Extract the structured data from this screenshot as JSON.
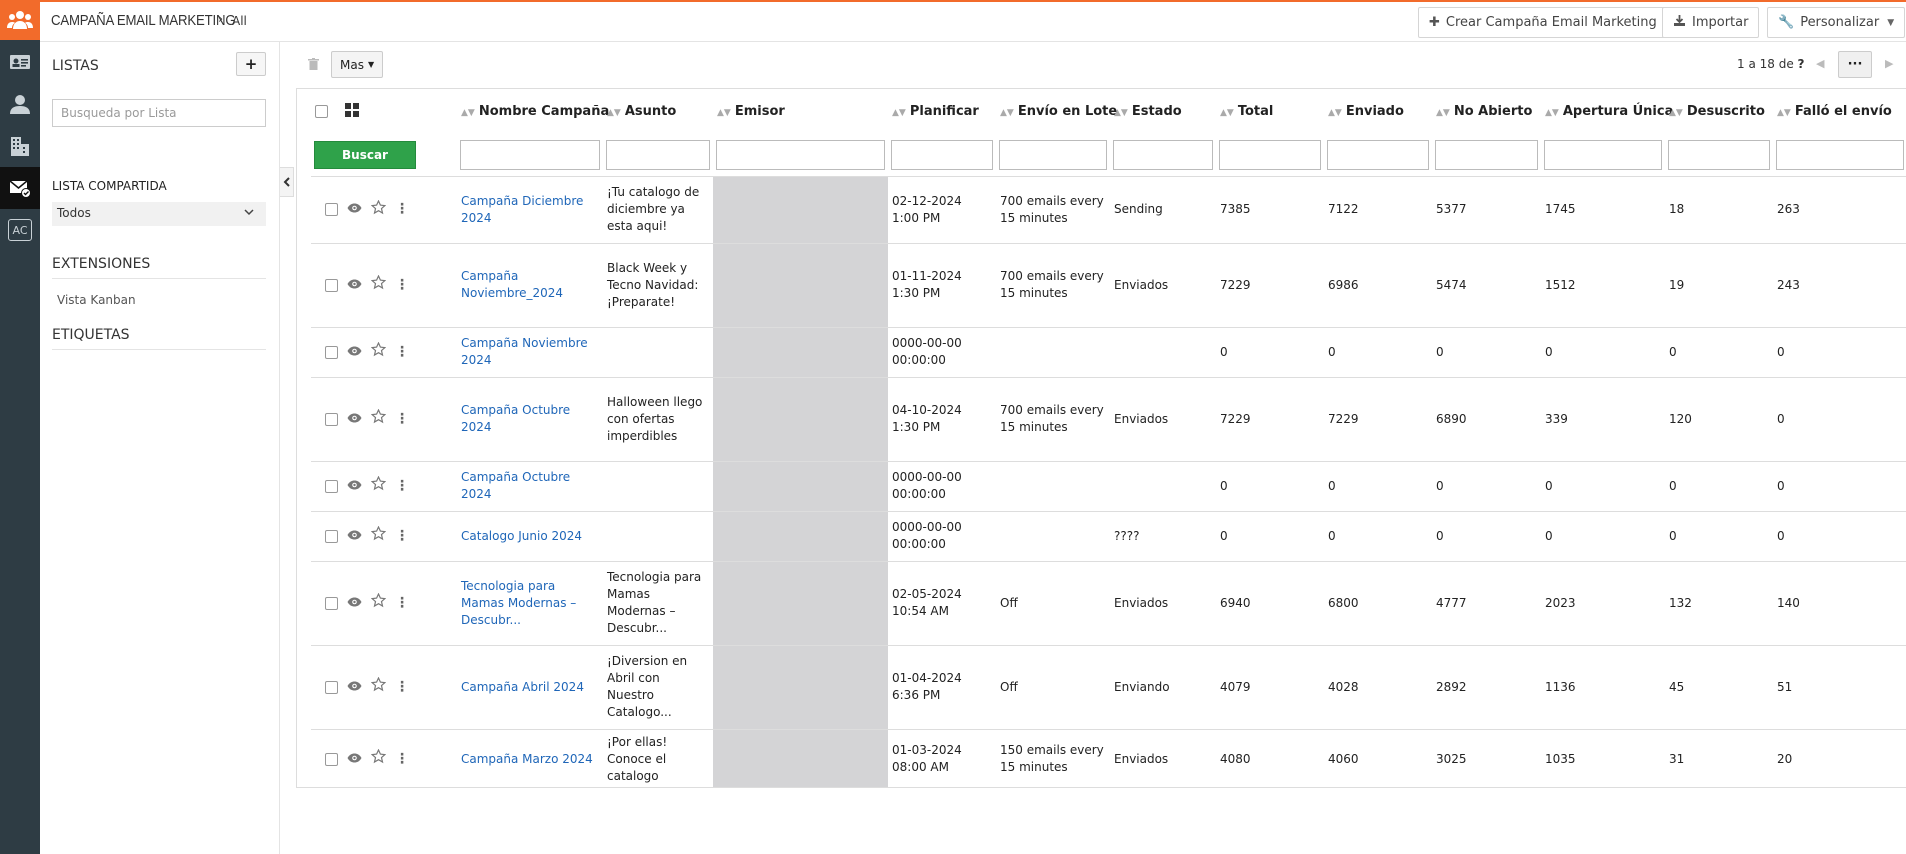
{
  "breadcrumb": {
    "module": "CAMPAÑA EMAIL MARKETING",
    "separator": "›",
    "view": "All"
  },
  "toolbar": {
    "create_label": "Crear Campaña Email Marketing",
    "import_label": "Importar",
    "customize_label": "Personalizar"
  },
  "sidebar": {
    "lists_title": "LISTAS",
    "add_label": "+",
    "search_placeholder": "Busqueda por Lista",
    "shared_list_label": "LISTA COMPARTIDA",
    "shared_list_value": "Todos",
    "extensions_title": "EXTENSIONES",
    "kanban_label": "Vista Kanban",
    "tags_title": "ETIQUETAS"
  },
  "list_toolbar": {
    "more_label": "Mas",
    "pager_text": "1 a 18  de",
    "pager_total": "?",
    "more_options": "···"
  },
  "columns": [
    "Nombre Campaña",
    "Asunto",
    "Emisor",
    "Planificar",
    "Envío en Lote",
    "Estado",
    "Total",
    "Enviado",
    "No Abierto",
    "Apertura Única",
    "Desuscrito",
    "Falló el envío"
  ],
  "search_button": "Buscar",
  "rows": [
    {
      "name": "Campaña Diciembre 2024",
      "subject": "¡Tu catalogo de diciembre ya esta aqui!",
      "schedule": "02-12-2024 1:00 PM",
      "batch": "700 emails every 15 minutes",
      "status": "Sending",
      "total": "7385",
      "sent": "7122",
      "unopened": "5377",
      "unique_open": "1745",
      "unsubscribed": "18",
      "failed": "263"
    },
    {
      "name": "Campaña Noviembre_2024",
      "subject": "Black Week y Tecno Navidad: ¡Preparate!",
      "schedule": "01-11-2024 1:30 PM",
      "batch": "700 emails every 15 minutes",
      "status": "Enviados",
      "total": "7229",
      "sent": "6986",
      "unopened": "5474",
      "unique_open": "1512",
      "unsubscribed": "19",
      "failed": "243"
    },
    {
      "name": "Campaña Noviembre 2024",
      "subject": "",
      "schedule": "0000-00-00 00:00:00",
      "batch": "",
      "status": "",
      "total": "0",
      "sent": "0",
      "unopened": "0",
      "unique_open": "0",
      "unsubscribed": "0",
      "failed": "0"
    },
    {
      "name": "Campaña Octubre 2024",
      "subject": "Halloween llego con ofertas imperdibles",
      "schedule": "04-10-2024 1:30 PM",
      "batch": "700 emails every 15 minutes",
      "status": "Enviados",
      "total": "7229",
      "sent": "7229",
      "unopened": "6890",
      "unique_open": "339",
      "unsubscribed": "120",
      "failed": "0"
    },
    {
      "name": "Campaña Octubre 2024",
      "subject": "",
      "schedule": "0000-00-00 00:00:00",
      "batch": "",
      "status": "",
      "total": "0",
      "sent": "0",
      "unopened": "0",
      "unique_open": "0",
      "unsubscribed": "0",
      "failed": "0"
    },
    {
      "name": "Catalogo Junio 2024",
      "subject": "",
      "schedule": "0000-00-00 00:00:00",
      "batch": "",
      "status": "????",
      "total": "0",
      "sent": "0",
      "unopened": "0",
      "unique_open": "0",
      "unsubscribed": "0",
      "failed": "0"
    },
    {
      "name": "Tecnologia para Mamas Modernas – Descubr...",
      "subject": "Tecnologia para Mamas Modernas – Descubr...",
      "schedule": "02-05-2024 10:54 AM",
      "batch": "Off",
      "status": "Enviados",
      "total": "6940",
      "sent": "6800",
      "unopened": "4777",
      "unique_open": "2023",
      "unsubscribed": "132",
      "failed": "140"
    },
    {
      "name": "Campaña Abril 2024",
      "subject": "¡Diversion en Abril con Nuestro Catalogo...",
      "schedule": "01-04-2024 6:36 PM",
      "batch": "Off",
      "status": "Enviando",
      "total": "4079",
      "sent": "4028",
      "unopened": "2892",
      "unique_open": "1136",
      "unsubscribed": "45",
      "failed": "51"
    },
    {
      "name": "Campaña Marzo 2024",
      "subject": "¡Por ellas! Conoce el catalogo",
      "schedule": "01-03-2024 08:00 AM",
      "batch": "150 emails every 15 minutes",
      "status": "Enviados",
      "total": "4080",
      "sent": "4060",
      "unopened": "3025",
      "unique_open": "1035",
      "unsubscribed": "31",
      "failed": "20"
    }
  ],
  "colors": {
    "accent": "#f26b2b",
    "rail": "#2e3c44",
    "link": "#1f66b8",
    "search_button": "#2fa24a"
  }
}
